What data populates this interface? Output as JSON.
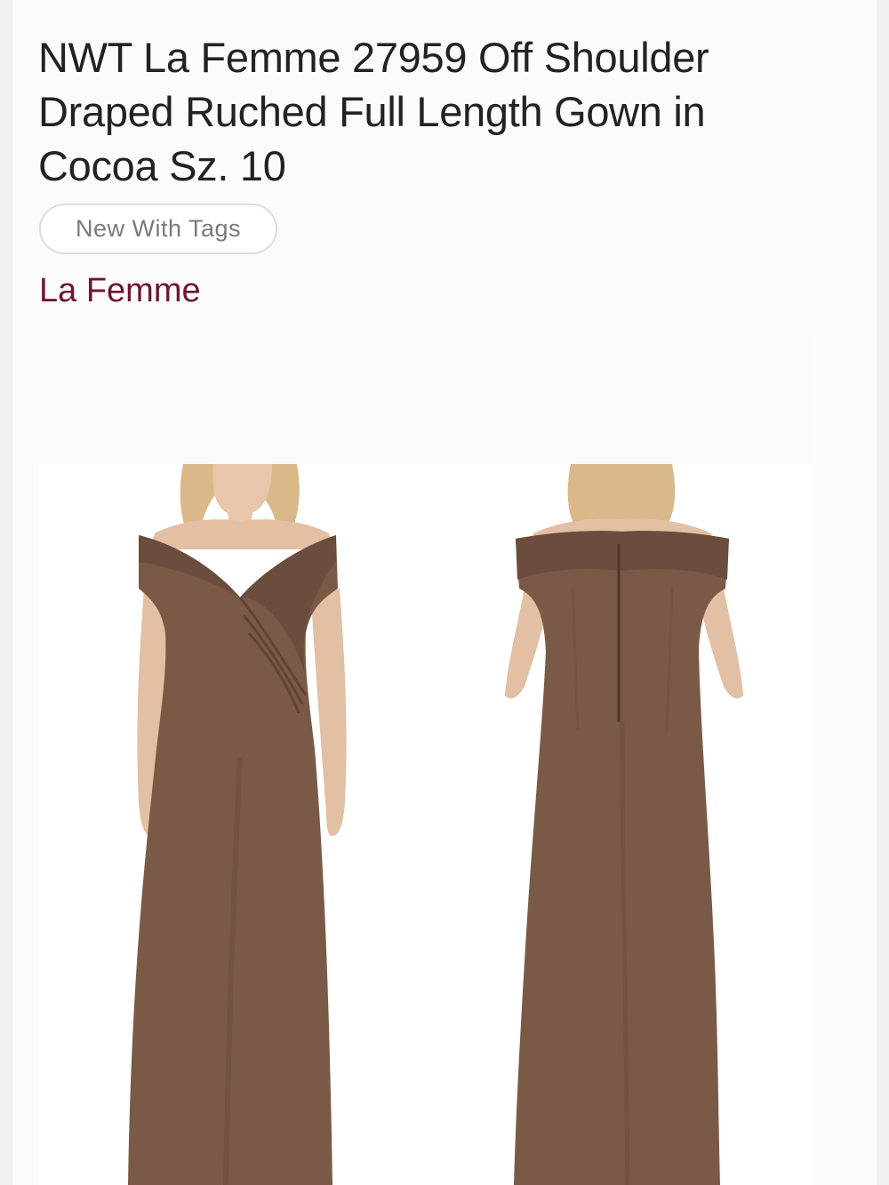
{
  "listing": {
    "title": "NWT La Femme 27959 Off Shoulder Draped Ruched Full Length Gown in Cocoa Sz. 10",
    "condition_badge": "New With Tags",
    "brand": "La Femme"
  },
  "colors": {
    "title": "#222222",
    "brand": "#6e1630",
    "badge_text": "#7a7a7a",
    "dress": "#7a5a47",
    "dress_shadow": "#5f4433",
    "skin": "#e3bfa4",
    "hair": "#d9b98a"
  },
  "photo": {
    "description_icon": "product-photo"
  }
}
